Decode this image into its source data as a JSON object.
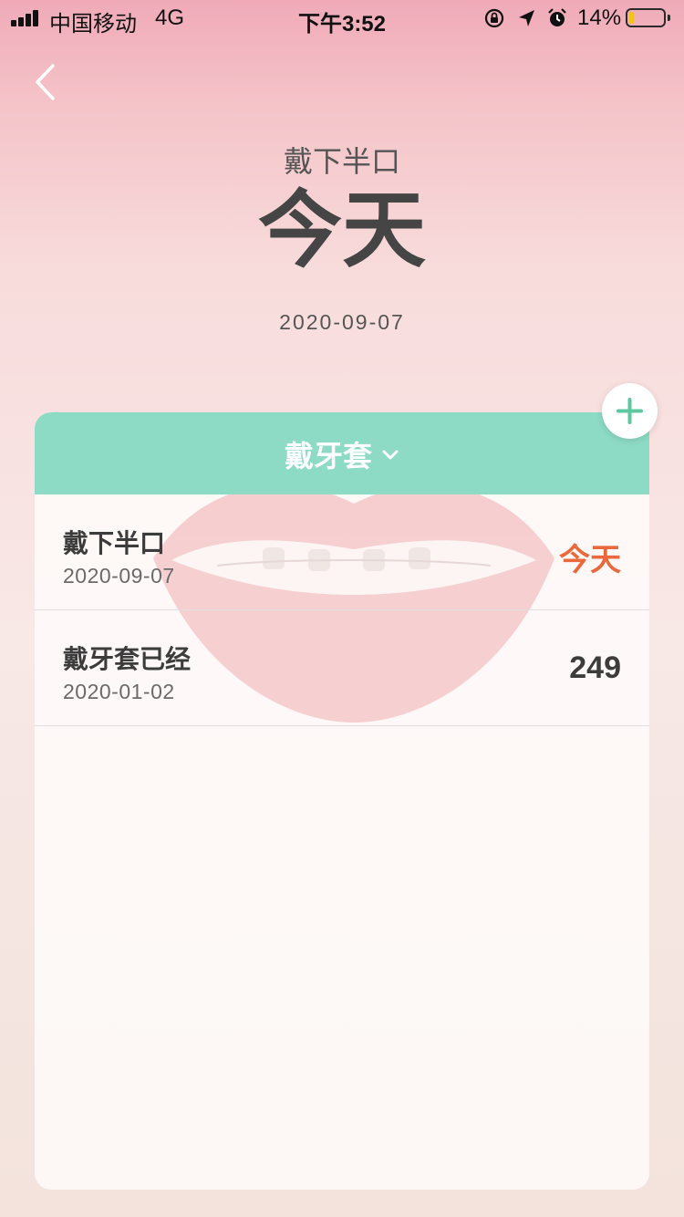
{
  "status_bar": {
    "carrier": "中国移动",
    "network": "4G",
    "time": "下午3:52",
    "battery_percent": "14%",
    "battery_level": 0.14,
    "icons": [
      "signal-icon",
      "lock-rotation-icon",
      "location-icon",
      "alarm-icon",
      "battery-icon"
    ]
  },
  "header": {
    "back_icon": "chevron-left-icon",
    "subtitle": "戴下半口",
    "title": "今天",
    "date": "2020-09-07"
  },
  "add_button": {
    "icon": "plus-icon",
    "color": "#5cc7a0"
  },
  "card": {
    "category_label": "戴牙套",
    "category_icon": "chevron-down-icon",
    "header_color": "#8ddbc5",
    "items": [
      {
        "title": "戴下半口",
        "date": "2020-09-07",
        "value": "今天",
        "value_color": "#e9683c"
      },
      {
        "title": "戴牙套已经",
        "date": "2020-01-02",
        "value": "249",
        "value_color": "#3c3c3c"
      }
    ]
  }
}
